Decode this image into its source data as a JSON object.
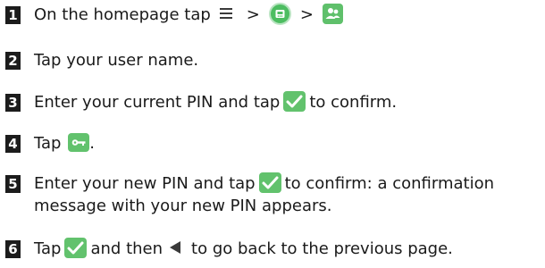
{
  "steps": [
    {
      "number": "1",
      "before_icons": "On the homepage tap",
      "sep1": ">",
      "sep2": ">"
    },
    {
      "number": "2",
      "text": "Tap your user name."
    },
    {
      "number": "3",
      "before": "Enter your current PIN and tap",
      "after": "to confirm."
    },
    {
      "number": "4",
      "before": "Tap",
      "after": "."
    },
    {
      "number": "5",
      "before": "Enter your new PIN and tap",
      "after": "to confirm: a confirmation",
      "line2": "message with your new PIN appears."
    },
    {
      "number": "6",
      "before": "Tap",
      "middle": "and then",
      "after": "to go back to the previous page."
    }
  ],
  "icons": {
    "menu": "menu-icon",
    "phone_app": "phone-app-icon",
    "users": "users-icon",
    "confirm": "check-icon",
    "key": "key-icon",
    "back": "back-arrow-icon"
  },
  "colors": {
    "green": "#62c26d",
    "number_badge": "#1c1c1c"
  }
}
